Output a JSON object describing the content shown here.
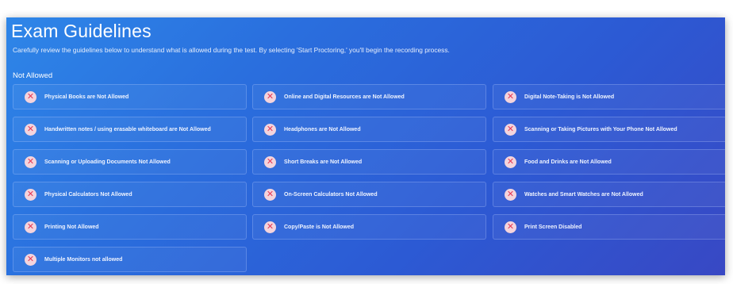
{
  "page": {
    "title": "Exam Guidelines",
    "subtitle": "Carefully review the guidelines below to understand what is allowed during the test. By selecting 'Start Proctoring,' you'll begin the recording process.",
    "section_title": "Not Allowed"
  },
  "icons": {
    "item_icon": "close-x-icon"
  },
  "colors": {
    "background_start": "#2e86e8",
    "background_end": "#3848c4",
    "icon_circle": "#f4d4dc",
    "icon_x": "#e53a55"
  },
  "items": [
    "Physical Books are Not Allowed",
    "Online and Digital Resources are Not Allowed",
    "Digital Note-Taking is Not Allowed",
    "Handwritten notes / using erasable whiteboard are Not Allowed",
    "Headphones are Not Allowed",
    "Scanning or Taking Pictures with Your Phone Not Allowed",
    "Scanning or Uploading Documents Not Allowed",
    "Short Breaks are Not Allowed",
    "Food and Drinks are Not Allowed",
    "Physical Calculators Not Allowed",
    "On-Screen Calculators Not Allowed",
    "Watches and Smart Watches are Not Allowed",
    "Printing Not Allowed",
    "Copy/Paste is Not Allowed",
    "Print Screen Disabled",
    "Multiple Monitors not allowed"
  ]
}
